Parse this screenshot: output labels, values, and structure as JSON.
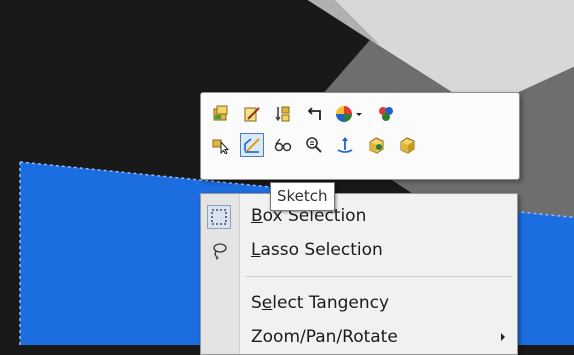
{
  "viewport": {
    "part_face_color": "#1c6de0",
    "background_color": "#191919"
  },
  "toolbar": {
    "row1": [
      {
        "icon": "feature-properties-icon"
      },
      {
        "icon": "edit-feature-icon"
      },
      {
        "icon": "suppress-icon"
      },
      {
        "icon": "rollback-icon"
      },
      {
        "icon": "appearance-dropdown-icon"
      },
      {
        "icon": "color-palette-icon"
      }
    ],
    "row2": [
      {
        "icon": "select-other-icon"
      },
      {
        "icon": "sketch-icon",
        "active": true
      },
      {
        "icon": "view-icon"
      },
      {
        "icon": "zoom-to-selection-icon"
      },
      {
        "icon": "normal-to-icon"
      },
      {
        "icon": "show-hide-body-icon"
      },
      {
        "icon": "isolate-body-icon"
      }
    ]
  },
  "tooltip": {
    "text": "Sketch"
  },
  "menu": {
    "items": [
      {
        "prefix": "",
        "accel": "B",
        "rest": "ox Selection",
        "icon": "box-select-icon",
        "checked": true
      },
      {
        "prefix": "",
        "accel": "L",
        "rest": "asso Selection",
        "icon": "lasso-icon"
      },
      {
        "prefix": "S",
        "accel": "e",
        "rest": "lect Tangency"
      },
      {
        "prefix": "Zoom/Pan/Rotate",
        "accel": "",
        "rest": "",
        "has_submenu": true
      }
    ]
  }
}
